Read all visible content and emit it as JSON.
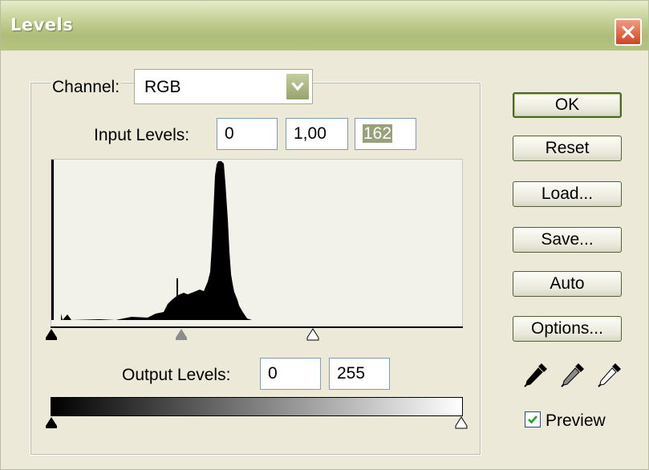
{
  "window": {
    "title": "Levels"
  },
  "channel": {
    "label": "Channel:",
    "value": "RGB"
  },
  "input_levels": {
    "label": "Input Levels:",
    "black": "0",
    "gamma": "1,00",
    "white": "162"
  },
  "output_levels": {
    "label": "Output Levels:",
    "black": "0",
    "white": "255"
  },
  "buttons": {
    "ok": "OK",
    "reset": "Reset",
    "load": "Load...",
    "save": "Save...",
    "auto": "Auto",
    "options": "Options..."
  },
  "preview": {
    "label": "Preview",
    "checked": true
  },
  "icons": {
    "close": "close-icon",
    "black_eyedropper": "eyedropper-black-icon",
    "gray_eyedropper": "eyedropper-gray-icon",
    "white_eyedropper": "eyedropper-white-icon"
  },
  "colors": {
    "title_bar": "#aebd78",
    "close_button": "#d2441f",
    "dialog_bg": "#ece9d8",
    "selection": "#98a07a"
  }
}
